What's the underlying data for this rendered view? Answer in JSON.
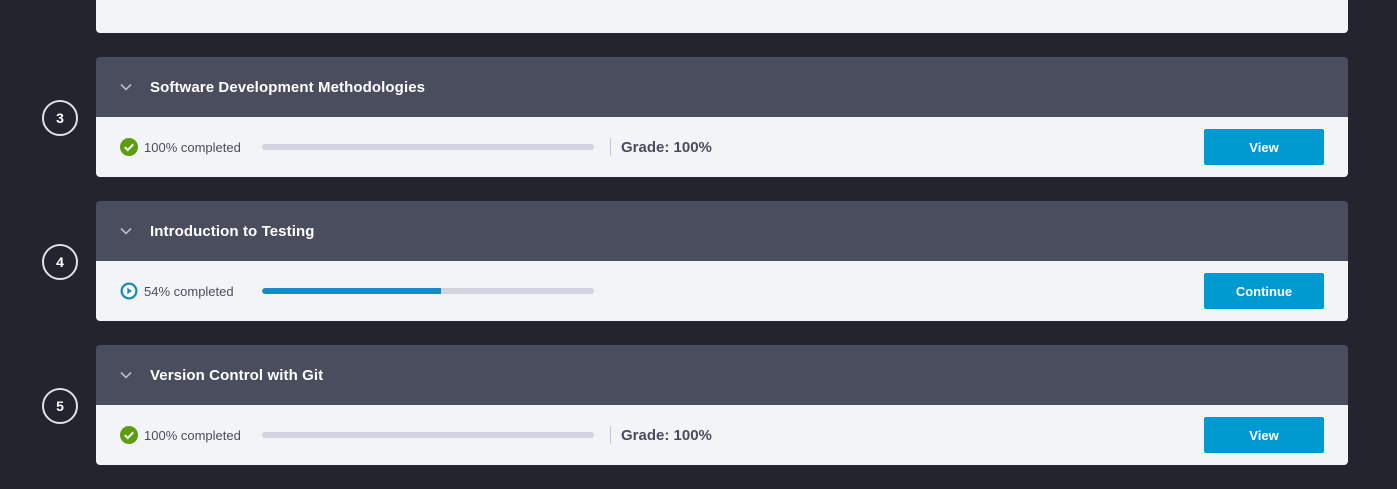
{
  "modules": [
    {
      "step": "3",
      "title": "Software Development Methodologies",
      "status": "completed",
      "progress_text": "100% completed",
      "progress_percent": 0,
      "grade": "Grade: 100%",
      "action_label": "View"
    },
    {
      "step": "4",
      "title": "Introduction to Testing",
      "status": "in-progress",
      "progress_text": "54% completed",
      "progress_percent": 54,
      "grade": "",
      "action_label": "Continue"
    },
    {
      "step": "5",
      "title": "Version Control with Git",
      "status": "completed",
      "progress_text": "100% completed",
      "progress_percent": 0,
      "grade": "Grade: 100%",
      "action_label": "View"
    }
  ],
  "icons": {
    "chevron": "chevron-down-icon",
    "completed": "check-circle-icon",
    "in_progress": "play-circle-icon"
  },
  "colors": {
    "background": "#23242e",
    "card_header": "#4a4d5d",
    "card_body": "#f3f4f8",
    "completed_green": "#5a9e0f",
    "in_progress_blue": "#1a8ac6",
    "button_blue": "#009ad1"
  }
}
